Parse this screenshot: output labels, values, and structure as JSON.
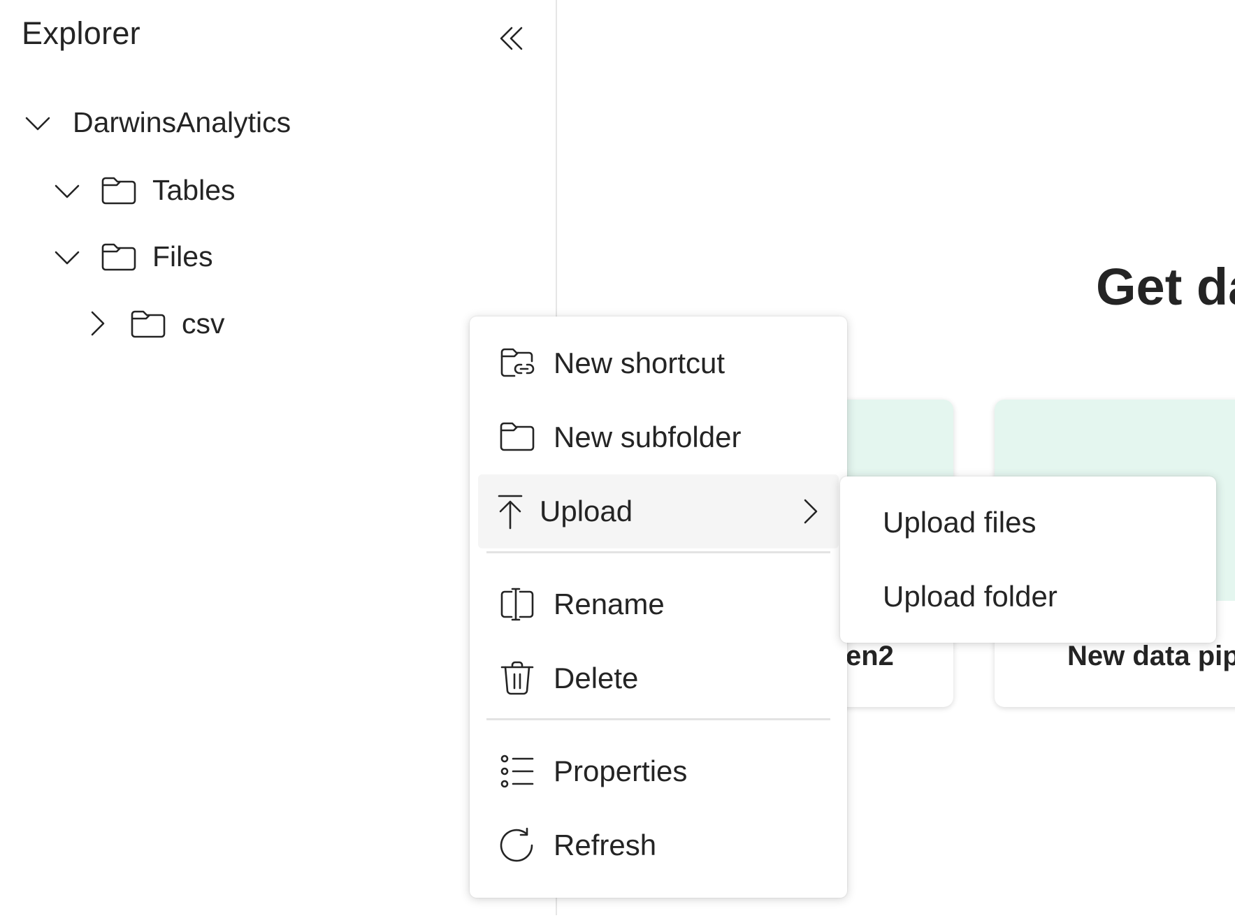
{
  "explorer": {
    "title": "Explorer",
    "collapse_icon": "double-chevron-left-icon",
    "tree": {
      "root": {
        "label": "DarwinsAnalytics",
        "expanded": true
      },
      "items": [
        {
          "label": "Tables",
          "expanded": true,
          "icon": "folder-icon"
        },
        {
          "label": "Files",
          "expanded": true,
          "icon": "folder-icon"
        },
        {
          "label": "csv",
          "expanded": false,
          "icon": "folder-icon"
        }
      ]
    }
  },
  "main": {
    "title": "Get da",
    "cards": [
      {
        "label": "en2"
      },
      {
        "label": "New data pip"
      }
    ]
  },
  "context_menu": {
    "items": [
      {
        "label": "New shortcut",
        "icon": "folder-link-icon"
      },
      {
        "label": "New subfolder",
        "icon": "folder-icon"
      },
      {
        "label": "Upload",
        "icon": "upload-icon",
        "has_submenu": true,
        "active": true
      },
      {
        "label": "Rename",
        "icon": "rename-icon"
      },
      {
        "label": "Delete",
        "icon": "trash-icon"
      },
      {
        "label": "Properties",
        "icon": "list-icon"
      },
      {
        "label": "Refresh",
        "icon": "refresh-icon"
      }
    ]
  },
  "upload_submenu": {
    "items": [
      {
        "label": "Upload files"
      },
      {
        "label": "Upload folder"
      }
    ]
  },
  "colors": {
    "card_accent": "#e4f6ef",
    "active_item_bg": "#f5f5f5",
    "text": "#242424"
  }
}
